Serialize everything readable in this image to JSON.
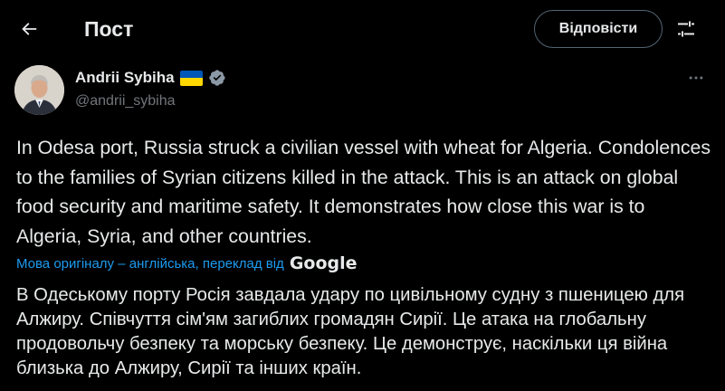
{
  "header": {
    "title": "Пост",
    "reply_label": "Відповісти"
  },
  "author": {
    "name": "Andrii Sybiha",
    "handle": "@andrii_sybiha",
    "flag": "ukraine-flag",
    "verified": true
  },
  "tweet": {
    "text": "In Odesa port, Russia struck a civilian vessel with wheat for Algeria. Condolences to the families of Syrian citizens killed in the attack. This is an attack on global food security and maritime safety. It demonstrates how close this war is to Algeria, Syria, and other countries."
  },
  "translation": {
    "notice": "Мова оригіналу – англійська, переклад від",
    "provider": "Google",
    "text": "В Одеському порту Росія завдала удару по цивільному судну з пшеницею для Алжиру. Співчуття сім'ям загиблих громадян Сирії. Це атака на глобальну продовольчу безпеку та морську безпеку. Це демонструє, наскільки ця війна близька до Алжиру, Сирії та інших країн."
  },
  "colors": {
    "background": "#000000",
    "text": "#e7e9ea",
    "secondary": "#71767b",
    "link": "#1d9bf0",
    "verified": "#8b98a5"
  }
}
